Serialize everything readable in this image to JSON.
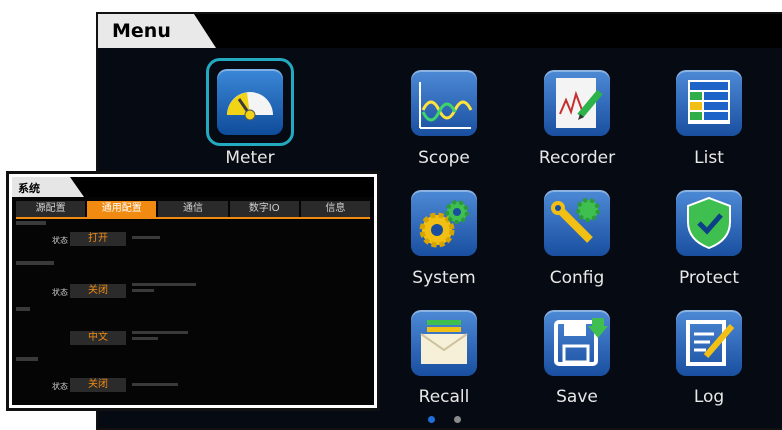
{
  "main": {
    "title": "Menu",
    "apps": [
      {
        "label": "Meter",
        "icon": "meter-gauge-icon",
        "selected": true
      },
      {
        "label": "Scope",
        "icon": "waveform-icon"
      },
      {
        "label": "Recorder",
        "icon": "recorder-chart-icon"
      },
      {
        "label": "List",
        "icon": "list-icon"
      },
      {
        "label": "System",
        "icon": "gears-icon"
      },
      {
        "label": "Config",
        "icon": "wrench-gear-icon"
      },
      {
        "label": "Protect",
        "icon": "shield-check-icon"
      },
      {
        "label": "Recall",
        "icon": "recall-tray-icon"
      },
      {
        "label": "Save",
        "icon": "floppy-disk-icon"
      },
      {
        "label": "Log",
        "icon": "notepad-icon"
      }
    ],
    "pagination": {
      "current": 1,
      "total": 2,
      "active_color": "#1e6fd9",
      "inactive_color": "#8a8a8a"
    }
  },
  "settings": {
    "title": "系统",
    "tabs": [
      "源配置",
      "通用配置",
      "通信",
      "数字IO",
      "信息"
    ],
    "active_tab": "通用配置",
    "sections": [
      {
        "row_label": "状态",
        "value": "打开"
      },
      {
        "row_label": "状态",
        "value": "关闭"
      },
      {
        "row_label": "",
        "value": "中文"
      },
      {
        "row_label": "状态",
        "value": "关闭"
      }
    ],
    "accent_color": "#f08a10"
  }
}
